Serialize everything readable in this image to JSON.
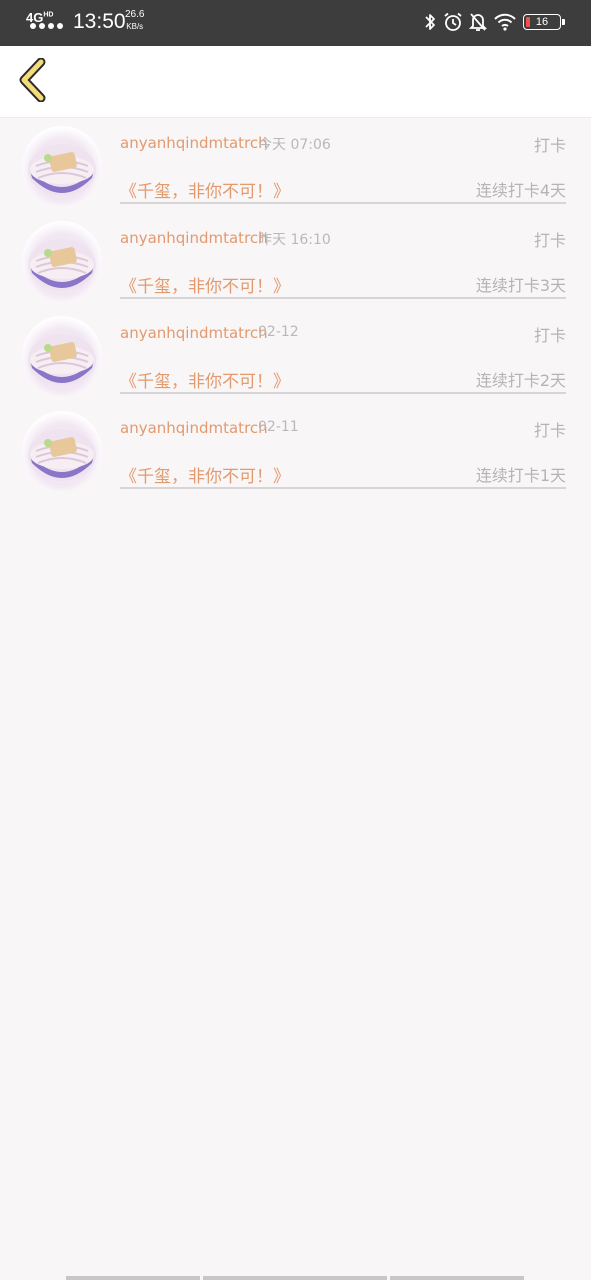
{
  "status_bar": {
    "network": "4G",
    "network_sup": "HD",
    "time": "13:50",
    "speed_value": "26.6",
    "speed_unit": "KB/s",
    "battery": "16"
  },
  "nav": {
    "back_icon": "chevron-left-icon"
  },
  "records": [
    {
      "username": "anyanhqindmtatrch",
      "time": "今天 07:06",
      "action": "打卡",
      "title": "《千玺，非你不可！》",
      "streak": "连续打卡4天"
    },
    {
      "username": "anyanhqindmtatrch",
      "time": "昨天 16:10",
      "action": "打卡",
      "title": "《千玺，非你不可！》",
      "streak": "连续打卡3天"
    },
    {
      "username": "anyanhqindmtatrch",
      "time": "02-12",
      "action": "打卡",
      "title": "《千玺，非你不可！》",
      "streak": "连续打卡2天"
    },
    {
      "username": "anyanhqindmtatrch",
      "time": "02-11",
      "action": "打卡",
      "title": "《千玺，非你不可！》",
      "streak": "连续打卡1天"
    }
  ],
  "colors": {
    "accent": "#e39a6e",
    "muted": "#b4b4b4",
    "background": "#f8f6f7"
  }
}
